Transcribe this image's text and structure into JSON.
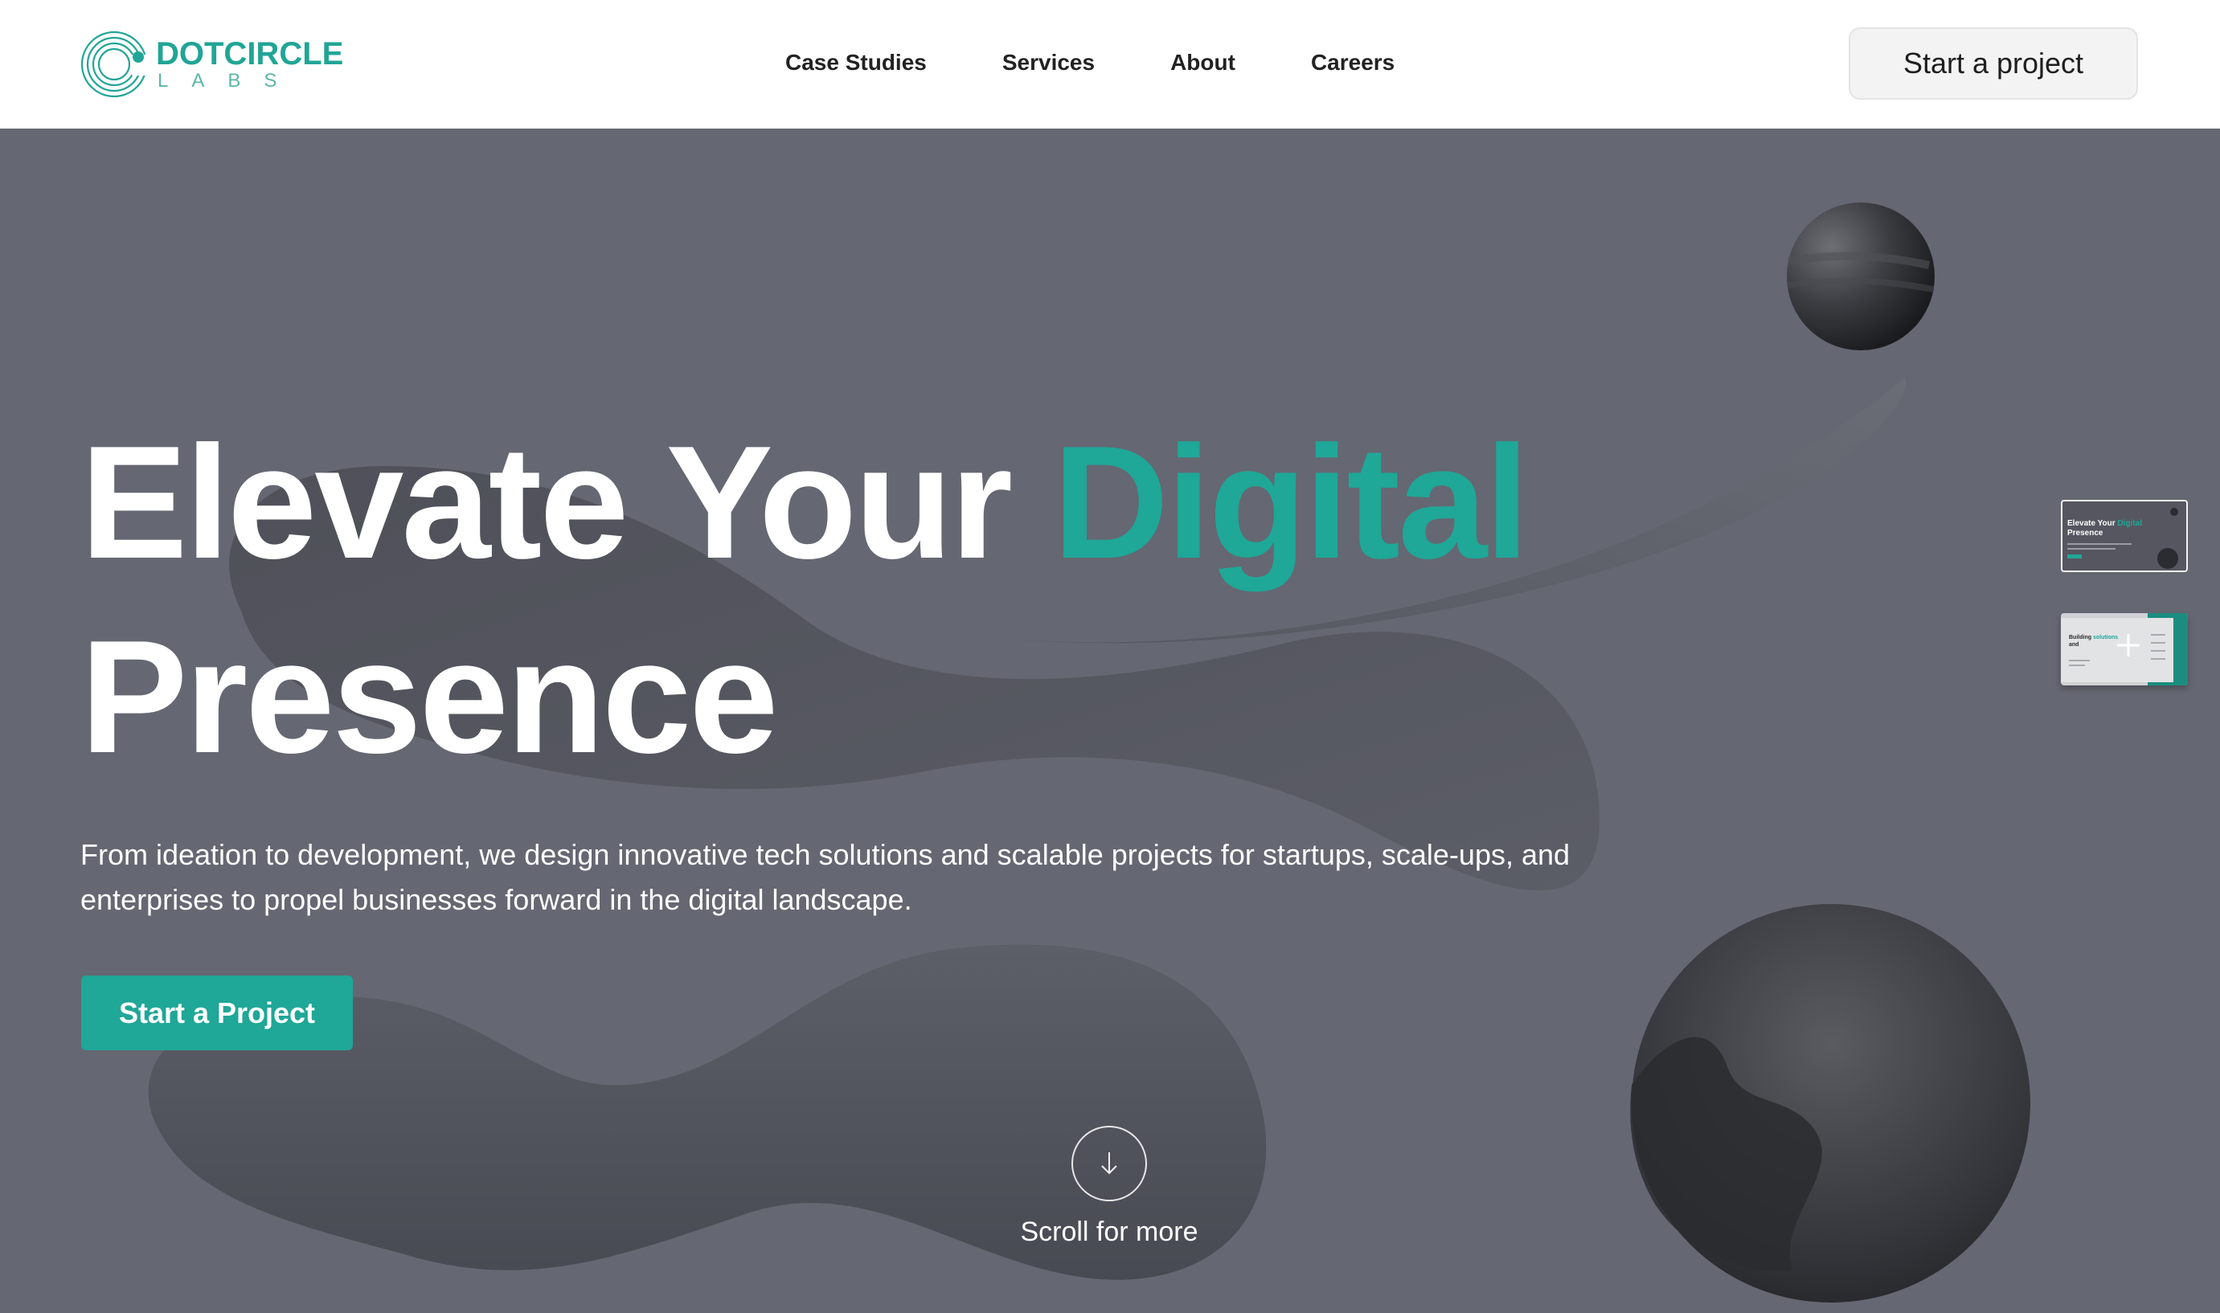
{
  "brand": {
    "name_main": "DOTCIRCLE",
    "name_sub": "LABS",
    "accent_color": "#1fa797"
  },
  "nav": {
    "items": [
      {
        "label": "Case Studies"
      },
      {
        "label": "Services"
      },
      {
        "label": "About"
      },
      {
        "label": "Careers"
      }
    ],
    "cta_label": "Start a project"
  },
  "hero": {
    "title_part1": "Elevate Your ",
    "title_accent": "Digital",
    "title_part2": "Presence",
    "description": "From ideation to development, we design innovative tech solutions and scalable projects for startups, scale-ups, and enterprises to propel businesses forward in the digital landscape.",
    "cta_label": "Start a Project",
    "scroll_label": "Scroll for more",
    "scroll_icon": "arrow-down-icon",
    "background_color": "#656772"
  },
  "slides": {
    "thumb1": {
      "title_part1": "Elevate Your",
      "title_accent": "Digital",
      "title_part2": "Presence"
    },
    "thumb2": {
      "title_part1": "Building",
      "title_accent": "solutions",
      "title_part2": "and"
    },
    "thumb2_icon": "plus-icon"
  }
}
